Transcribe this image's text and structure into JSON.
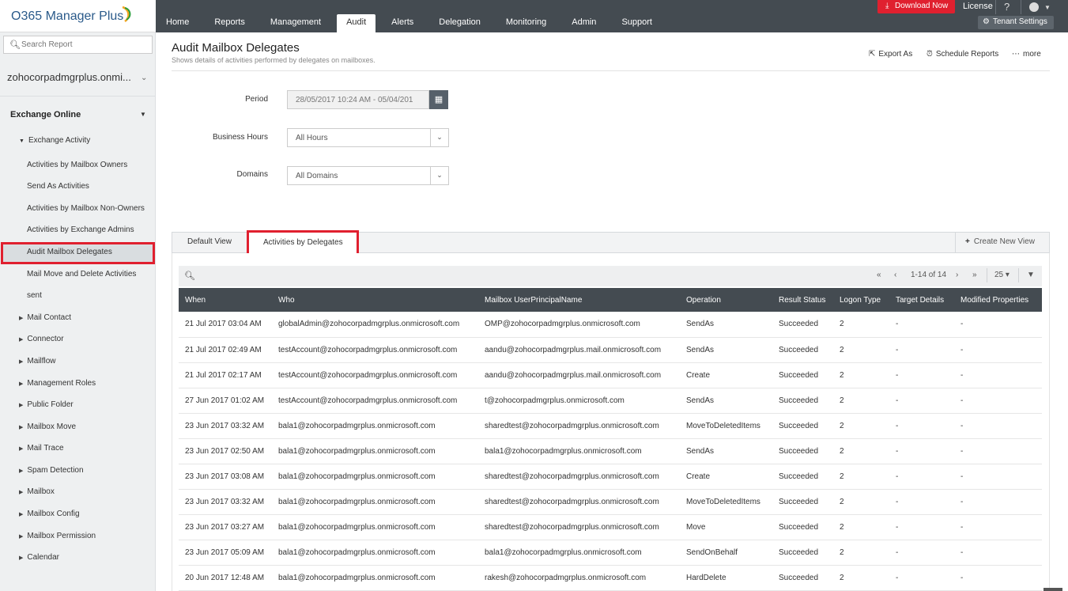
{
  "app": {
    "logo_text": "O365 Manager Plus",
    "nav": [
      "Home",
      "Reports",
      "Management",
      "Audit",
      "Alerts",
      "Delegation",
      "Monitoring",
      "Admin",
      "Support"
    ],
    "nav_active": "Audit",
    "download_label": "Download Now",
    "license_label": "License",
    "help_label": "?",
    "tenant_settings_label": "Tenant Settings",
    "accent_color": "#e0202f",
    "header_color": "#444b51"
  },
  "sidebar": {
    "search_placeholder": "Search Report",
    "tenant": "zohocorpadmgrplus.onmi...",
    "section": "Exchange Online",
    "sub_section": "Exchange Activity",
    "links": [
      "Activities by Mailbox Owners",
      "Send As Activities",
      "Activities by Mailbox Non-Owners",
      "Activities by Exchange Admins",
      "Audit Mailbox Delegates",
      "Mail Move and Delete Activities",
      "sent"
    ],
    "active_link": "Audit Mailbox Delegates",
    "groups": [
      "Mail Contact",
      "Connector",
      "Mailflow",
      "Management Roles",
      "Public Folder",
      "Mailbox Move",
      "Mail Trace",
      "Spam Detection",
      "Mailbox",
      "Mailbox Config",
      "Mailbox Permission",
      "Calendar"
    ]
  },
  "page": {
    "title": "Audit Mailbox Delegates",
    "subtitle": "Shows details of activities performed by delegates on mailboxes.",
    "export_label": "Export As",
    "schedule_label": "Schedule Reports",
    "more_label": "more"
  },
  "filters": {
    "period_label": "Period",
    "period_value": "28/05/2017 10:24 AM - 05/04/201",
    "hours_label": "Business Hours",
    "hours_value": "All Hours",
    "domains_label": "Domains",
    "domains_value": "All Domains"
  },
  "tabs": {
    "default": "Default View",
    "active": "Activities by Delegates",
    "create": "Create New View"
  },
  "grid": {
    "pager_text": "1-14 of 14",
    "page_size": "25",
    "columns": [
      "When",
      "Who",
      "Mailbox UserPrincipalName",
      "Operation",
      "Result Status",
      "Logon Type",
      "Target Details",
      "Modified Properties"
    ],
    "rows": [
      [
        "21 Jul 2017 03:04 AM",
        "globalAdmin@zohocorpadmgrplus.onmicrosoft.com",
        "OMP@zohocorpadmgrplus.onmicrosoft.com",
        "SendAs",
        "Succeeded",
        "2",
        "-",
        "-"
      ],
      [
        "21 Jul 2017 02:49 AM",
        "testAccount@zohocorpadmgrplus.onmicrosoft.com",
        "aandu@zohocorpadmgrplus.mail.onmicrosoft.com",
        "SendAs",
        "Succeeded",
        "2",
        "-",
        "-"
      ],
      [
        "21 Jul 2017 02:17 AM",
        "testAccount@zohocorpadmgrplus.onmicrosoft.com",
        "aandu@zohocorpadmgrplus.mail.onmicrosoft.com",
        "Create",
        "Succeeded",
        "2",
        "-",
        "-"
      ],
      [
        "27 Jun 2017 01:02 AM",
        "testAccount@zohocorpadmgrplus.onmicrosoft.com",
        "t@zohocorpadmgrplus.onmicrosoft.com",
        "SendAs",
        "Succeeded",
        "2",
        "-",
        "-"
      ],
      [
        "23 Jun 2017 03:32 AM",
        "bala1@zohocorpadmgrplus.onmicrosoft.com",
        "sharedtest@zohocorpadmgrplus.onmicrosoft.com",
        "MoveToDeletedItems",
        "Succeeded",
        "2",
        "-",
        "-"
      ],
      [
        "23 Jun 2017 02:50 AM",
        "bala1@zohocorpadmgrplus.onmicrosoft.com",
        "bala1@zohocorpadmgrplus.onmicrosoft.com",
        "SendAs",
        "Succeeded",
        "2",
        "-",
        "-"
      ],
      [
        "23 Jun 2017 03:08 AM",
        "bala1@zohocorpadmgrplus.onmicrosoft.com",
        "sharedtest@zohocorpadmgrplus.onmicrosoft.com",
        "Create",
        "Succeeded",
        "2",
        "-",
        "-"
      ],
      [
        "23 Jun 2017 03:32 AM",
        "bala1@zohocorpadmgrplus.onmicrosoft.com",
        "sharedtest@zohocorpadmgrplus.onmicrosoft.com",
        "MoveToDeletedItems",
        "Succeeded",
        "2",
        "-",
        "-"
      ],
      [
        "23 Jun 2017 03:27 AM",
        "bala1@zohocorpadmgrplus.onmicrosoft.com",
        "sharedtest@zohocorpadmgrplus.onmicrosoft.com",
        "Move",
        "Succeeded",
        "2",
        "-",
        "-"
      ],
      [
        "23 Jun 2017 05:09 AM",
        "bala1@zohocorpadmgrplus.onmicrosoft.com",
        "bala1@zohocorpadmgrplus.onmicrosoft.com",
        "SendOnBehalf",
        "Succeeded",
        "2",
        "-",
        "-"
      ],
      [
        "20 Jun 2017 12:48 AM",
        "bala1@zohocorpadmgrplus.onmicrosoft.com",
        "rakesh@zohocorpadmgrplus.onmicrosoft.com",
        "HardDelete",
        "Succeeded",
        "2",
        "-",
        "-"
      ]
    ]
  }
}
